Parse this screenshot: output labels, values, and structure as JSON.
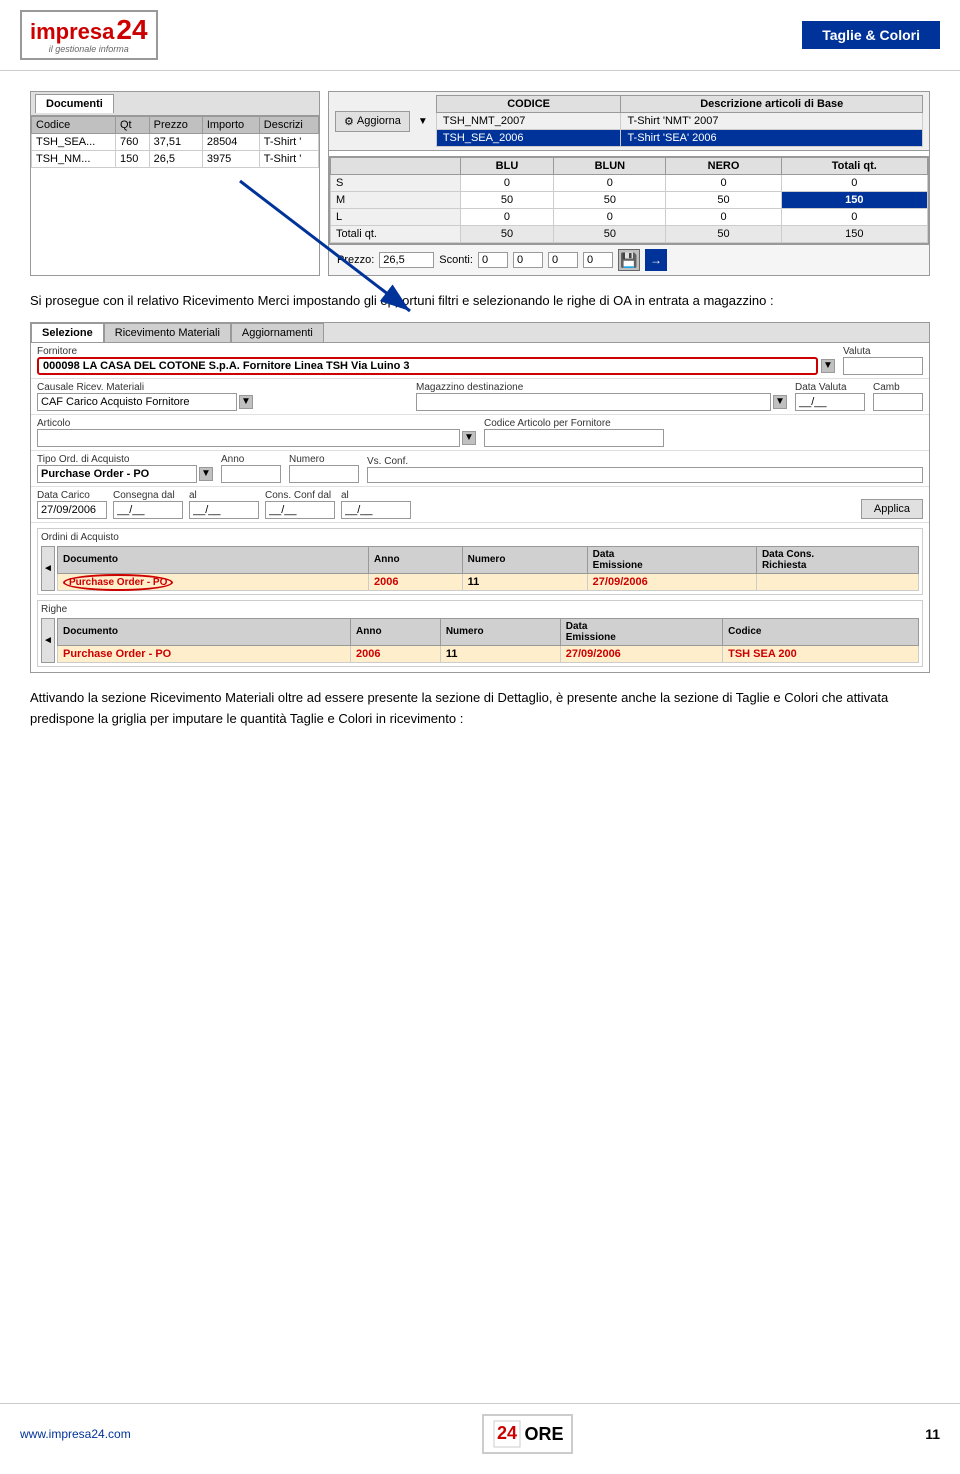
{
  "header": {
    "logo_number": "24",
    "logo_name": "impresa",
    "logo_subtitle": "il gestionale informa",
    "title": "Taglie & Colori"
  },
  "top_table": {
    "tab": "Documenti",
    "columns": [
      "Codice",
      "Qt",
      "Prezzo",
      "Importo",
      "Descrizi"
    ],
    "rows": [
      [
        "TSH_SEA...",
        "760",
        "37,51",
        "28504",
        "T-Shirt '"
      ],
      [
        "TSH_NM...",
        "150",
        "26,5",
        "3975",
        "T-Shirt '"
      ]
    ]
  },
  "article_panel": {
    "button_label": "Aggiorna",
    "columns": [
      "CODICE",
      "Descrizione articoli di Base"
    ],
    "rows": [
      [
        "TSH_NMT_2007",
        "T-Shirt 'NMT' 2007"
      ],
      [
        "TSH_SEA_2006",
        "T-Shirt 'SEA' 2006"
      ]
    ]
  },
  "size_grid": {
    "columns": [
      "",
      "BLU",
      "BLUN",
      "NERO",
      "Totali qt."
    ],
    "rows": [
      [
        "S",
        "0",
        "0",
        "0",
        "0"
      ],
      [
        "M",
        "50",
        "50",
        "50",
        "150"
      ],
      [
        "L",
        "0",
        "0",
        "0",
        "0"
      ],
      [
        "Totali qt.",
        "50",
        "50",
        "50",
        "150"
      ]
    ],
    "highlighted_row": 1
  },
  "price_bar": {
    "prezzo_label": "Prezzo:",
    "prezzo_value": "26,5",
    "sconti_label": "Sconti:",
    "sconti_values": [
      "0",
      "0",
      "0",
      "0"
    ]
  },
  "description1": "Si prosegue con il relativo Ricevimento Merci  impostando gli opportuni filtri  e selezionando le righe di OA in entrata a magazzino :",
  "form": {
    "tabs": [
      "Selezione",
      "Ricevimento Materiali",
      "Aggiornamenti"
    ],
    "active_tab": "Selezione",
    "fornitore_label": "Fornitore",
    "fornitore_value": "000098 LA CASA DEL COTONE S.p.A. Fornitore Linea TSH Via Luino 3",
    "valuta_label": "Valuta",
    "causale_label": "Causale Ricev. Materiali",
    "causale_value": "CAF Carico Acquisto Fornitore",
    "magazzino_label": "Magazzino destinazione",
    "data_valuta_label": "Data Valuta",
    "data_valuta_value": "__/__",
    "cambio_label": "Camb",
    "articolo_label": "Articolo",
    "codice_art_fornitore_label": "Codice Articolo per Fornitore",
    "tipo_ord_label": "Tipo Ord. di Acquisto",
    "tipo_ord_value": "Purchase Order - PO",
    "anno_label": "Anno",
    "numero_label": "Numero",
    "vs_conf_label": "Vs. Conf.",
    "data_carico_label": "Data Carico",
    "data_carico_value": "27/09/2006",
    "consegna_dal_label": "Consegna dal",
    "consegna_al_label": "al",
    "cons_conf_dal_label": "Cons. Conf dal",
    "cons_conf_dal_value": "__/__",
    "cons_conf_al_label": "al",
    "cons_conf_al_value": "__/__",
    "applica_label": "Applica",
    "ordini_acquisto_label": "Ordini di Acquisto",
    "ordini_columns": [
      "Documento",
      "Anno",
      "Numero",
      "Data Emissione",
      "Data Cons. Richiesta"
    ],
    "ordini_row": {
      "documento": "Purchase Order - PO",
      "anno": "2006",
      "numero": "11",
      "data_emissione": "27/09/2006",
      "data_cons": ""
    },
    "righe_label": "Righe",
    "righe_columns": [
      "Documento",
      "Anno",
      "Numero",
      "Data Emissione",
      "Codice"
    ],
    "righe_row": {
      "documento": "Purchase Order - PO",
      "anno": "2006",
      "numero": "11",
      "data_emissione": "27/09/2006",
      "codice": "TSH SEA 200"
    }
  },
  "description2": "Attivando la sezione Ricevimento Materiali oltre ad essere presente la sezione di Dettaglio, è presente anche la sezione di Taglie e Colori che attivata predispone la griglia per imputare le quantità Taglie e Colori in ricevimento :",
  "footer": {
    "url": "www.impresa24.com",
    "page_number": "11"
  }
}
